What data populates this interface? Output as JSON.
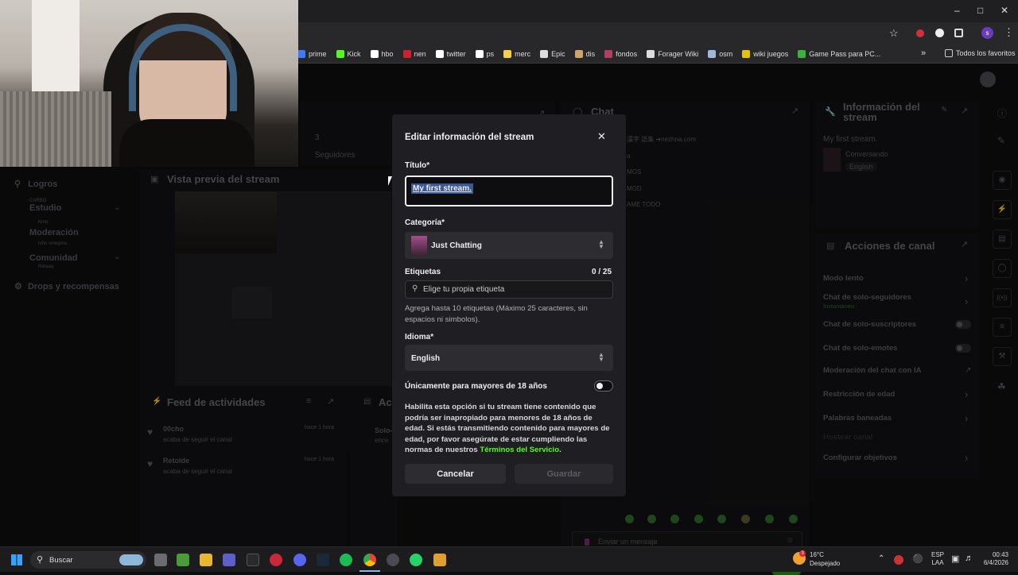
{
  "browser": {
    "bookmarks": [
      {
        "label": "prime",
        "color": "#3d7bff"
      },
      {
        "label": "Kick",
        "color": "#53fc18"
      },
      {
        "label": "hbo",
        "color": "#ffffff"
      },
      {
        "label": "nen",
        "color": "#d11f2e"
      },
      {
        "label": "twitter",
        "color": "#ffffff"
      },
      {
        "label": "ps",
        "color": "#ffffff"
      },
      {
        "label": "merc",
        "color": "#f2d04a"
      },
      {
        "label": "Epic",
        "color": "#dddddd"
      },
      {
        "label": "dis",
        "color": "#cfa46a"
      },
      {
        "label": "fondos",
        "color": "#b04060"
      },
      {
        "label": "Forager Wiki",
        "color": "#dddddd"
      },
      {
        "label": "osm",
        "color": "#9fb7d8"
      },
      {
        "label": "wiki juegos",
        "color": "#e6c400"
      },
      {
        "label": "Game Pass para PC...",
        "color": "#3bb33b"
      }
    ],
    "all_favorites": "Todos los favoritos",
    "profile_initial": "s"
  },
  "dashboard": {
    "followers_count": "3",
    "followers_label": "Seguidores",
    "chat_title": "Chat",
    "chat_lines": [
      "nezhna.com",
      "a",
      "MOS",
      "MOD",
      "AME TODO"
    ],
    "chat_line0_prefix": "漢字 語集 ➔",
    "stream_preview_title": "Vista previa del stream",
    "sidebar": [
      {
        "label": "Logros"
      },
      {
        "label": "Estudio",
        "sub": "CARBO"
      },
      {
        "label": "Moderación",
        "sub": "Kmo"
      },
      {
        "label": "Comunidad",
        "sub": "niño smegma"
      },
      {
        "label": "Drops y recompensas",
        "sub": "Retaaa"
      }
    ],
    "activity_title": "Feed de actividades",
    "activity_items": [
      {
        "user": "00cho",
        "desc": "acaba de seguir el canal",
        "time": "hace 1 hora"
      },
      {
        "user": "Retoide",
        "desc": "acaba de seguir el canal",
        "time": "hace 1 hora"
      }
    ],
    "mid_panel_title": "Ac",
    "mid_panel_item": "Solo-",
    "mid_panel_item2": "ence",
    "info_title": "Información del stream",
    "info_stream_title": "My first stream.",
    "info_category": "Conversando",
    "info_language": "English",
    "actions_title": "Acciones de canal",
    "actions": [
      {
        "label": "Modo lento",
        "kind": "chevron"
      },
      {
        "label": "Chat de solo-seguidores",
        "sub": "Instantáneo",
        "kind": "chevron"
      },
      {
        "label": "Chat de solo-suscriptores",
        "kind": "toggle"
      },
      {
        "label": "Chat de solo-emotes",
        "kind": "toggle"
      },
      {
        "label": "Moderación del chat con IA",
        "kind": "external"
      },
      {
        "label": "Restricción de edad",
        "kind": "chevron"
      },
      {
        "label": "Palabras baneadas",
        "kind": "chevron"
      },
      {
        "label": "Hostear canal",
        "kind": "none"
      },
      {
        "label": "Configurar objetivos",
        "kind": "chevron"
      }
    ],
    "chat_input_placeholder": "Enviar un mensaje",
    "chat_button": "Chat"
  },
  "modal": {
    "title": "Editar información del stream",
    "title_label": "Título*",
    "title_value": "My first stream.",
    "category_label": "Categoría*",
    "category_value": "Just Chatting",
    "tags_label": "Etiquetas",
    "tags_count": "0 / 25",
    "tags_placeholder": "Elige tu propia etiqueta",
    "tags_help": "Agrega hasta 10 etiquetas (Máximo 25 caracteres, sin espacios ni simbolos).",
    "language_label": "Idioma*",
    "language_value": "English",
    "adult_label": "Únicamente para mayores de 18 años",
    "adult_help": "Habilita esta opción si tu stream tiene contenido que podría ser inapropiado para menores de 18 años de edad. Si estás transmitiendo contenido para mayores de edad, por favor asegúrate de estar cumpliendo las normas de nuestros",
    "adult_link": "Términos del Servicio",
    "adult_link_tail": ".",
    "adult_enabled": false,
    "cancel": "Cancelar",
    "save": "Guardar",
    "accent": "#53fc18"
  },
  "taskbar": {
    "search": "Buscar",
    "weather_temp": "16°C",
    "weather_desc": "Despejado",
    "weather_badge": "3",
    "lang_top": "ESP",
    "lang_bottom": "LAA",
    "time": "00:43",
    "date": "6/4/2026"
  }
}
